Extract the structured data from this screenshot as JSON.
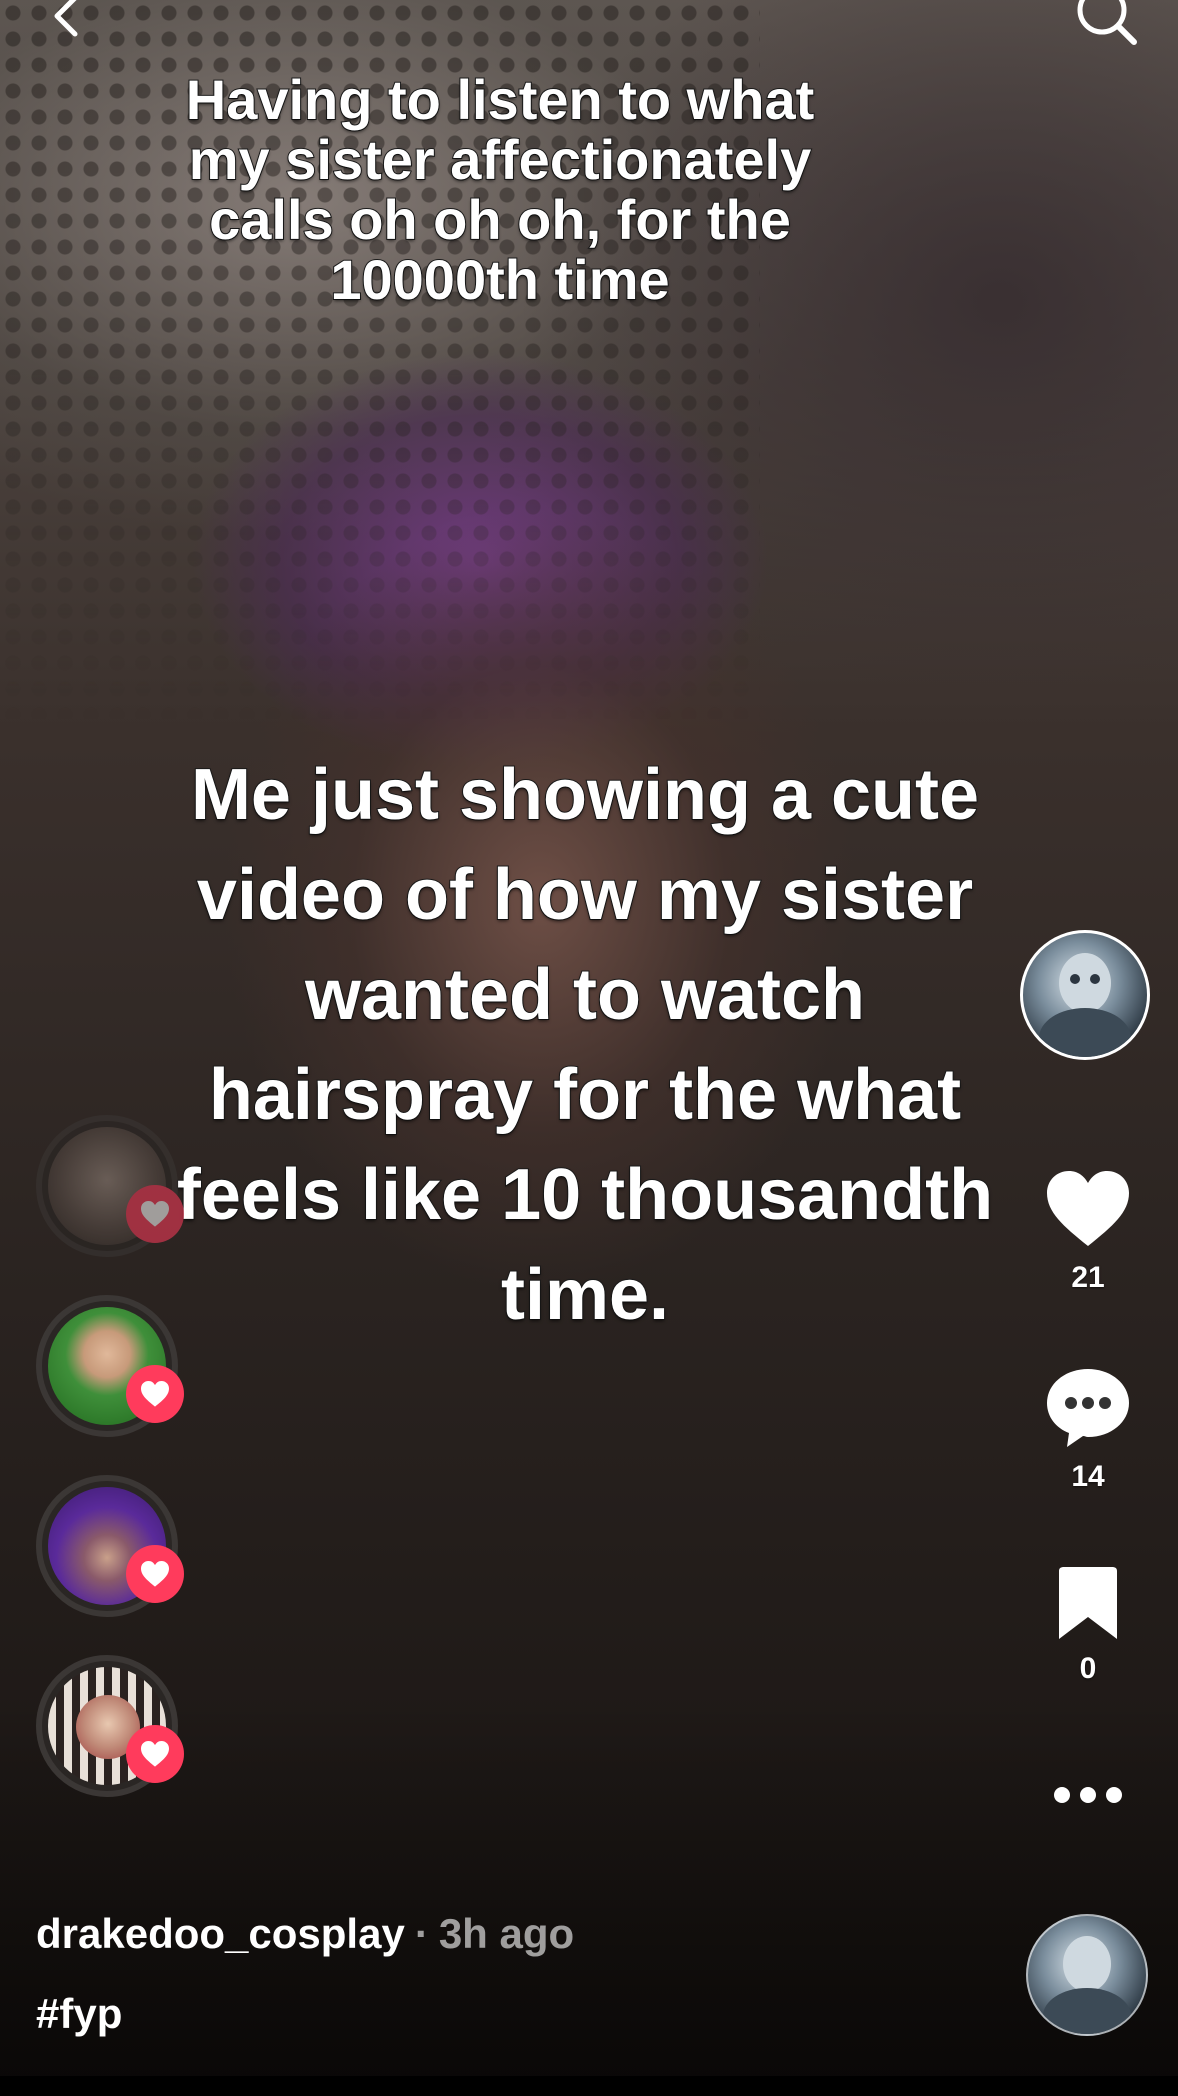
{
  "captions": {
    "top": "Having to listen to what\nmy sister affectionately\ncalls oh oh oh, for the\n10000th time",
    "center": "Me just showing a cute\nvideo of how my sister\nwanted to watch\nhairspray for the what\nfeels like 10 thousandth\ntime."
  },
  "actions": {
    "likes": "21",
    "comments": "14",
    "bookmarks": "0"
  },
  "post": {
    "username": "drakedoo_cosplay",
    "separator": "·",
    "time_ago": "3h ago",
    "hashtag": "#fyp"
  },
  "colors": {
    "heart_badge": "#ff3b5c",
    "text": "#ffffff"
  },
  "icons": [
    "back-arrow-icon",
    "search-icon",
    "heart-icon",
    "comment-icon",
    "bookmark-icon",
    "more-icon"
  ]
}
